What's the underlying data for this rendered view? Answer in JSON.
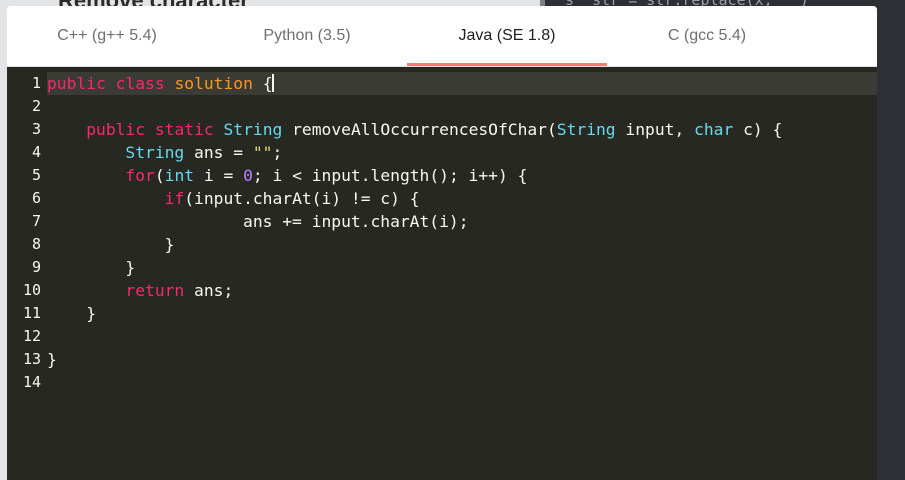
{
  "background": {
    "heading": "Remove character",
    "code_snippet": "s  str = str.replace(x, '')"
  },
  "tabs": [
    {
      "label": "C++ (g++ 5.4)",
      "active": false
    },
    {
      "label": "Python (3.5)",
      "active": false
    },
    {
      "label": "Java (SE 1.8)",
      "active": true
    },
    {
      "label": "C (gcc 5.4)",
      "active": false
    }
  ],
  "editor": {
    "active_line": 1,
    "line_numbers": [
      "1",
      "2",
      "3",
      "4",
      "5",
      "6",
      "7",
      "8",
      "9",
      "10",
      "11",
      "12",
      "13",
      "14"
    ],
    "lines": [
      [
        {
          "t": "public",
          "c": "kw"
        },
        {
          "t": " "
        },
        {
          "t": "class",
          "c": "kw"
        },
        {
          "t": " "
        },
        {
          "t": "solution",
          "c": "cls"
        },
        {
          "t": " {"
        }
      ],
      [],
      [
        {
          "t": "    "
        },
        {
          "t": "public",
          "c": "kw"
        },
        {
          "t": " "
        },
        {
          "t": "static",
          "c": "kw"
        },
        {
          "t": " "
        },
        {
          "t": "String",
          "c": "ty"
        },
        {
          "t": " removeAllOccurrencesOfChar("
        },
        {
          "t": "String",
          "c": "ty"
        },
        {
          "t": " input, "
        },
        {
          "t": "char",
          "c": "ty"
        },
        {
          "t": " c) {"
        }
      ],
      [
        {
          "t": "        "
        },
        {
          "t": "String",
          "c": "ty"
        },
        {
          "t": " ans = "
        },
        {
          "t": "\"\"",
          "c": "str"
        },
        {
          "t": ";"
        }
      ],
      [
        {
          "t": "        "
        },
        {
          "t": "for",
          "c": "kw"
        },
        {
          "t": "("
        },
        {
          "t": "int",
          "c": "ty"
        },
        {
          "t": " i = "
        },
        {
          "t": "0",
          "c": "num"
        },
        {
          "t": "; i < input.length(); i++) {"
        }
      ],
      [
        {
          "t": "            "
        },
        {
          "t": "if",
          "c": "kw"
        },
        {
          "t": "(input.charAt(i) != c) {"
        }
      ],
      [
        {
          "t": "                    ans += input.charAt(i);"
        }
      ],
      [
        {
          "t": "            }"
        }
      ],
      [
        {
          "t": "        }"
        }
      ],
      [
        {
          "t": "        "
        },
        {
          "t": "return",
          "c": "kw"
        },
        {
          "t": " ans;"
        }
      ],
      [
        {
          "t": "    }"
        }
      ],
      [],
      [
        {
          "t": "}"
        }
      ],
      []
    ]
  },
  "colors": {
    "editor_bg": "#272822",
    "keyword": "#f92672",
    "type": "#66d9ef",
    "class_name": "#fd971f",
    "string": "#e6db74",
    "number": "#ae81ff",
    "active_tab_underline": "#f27c7c"
  }
}
